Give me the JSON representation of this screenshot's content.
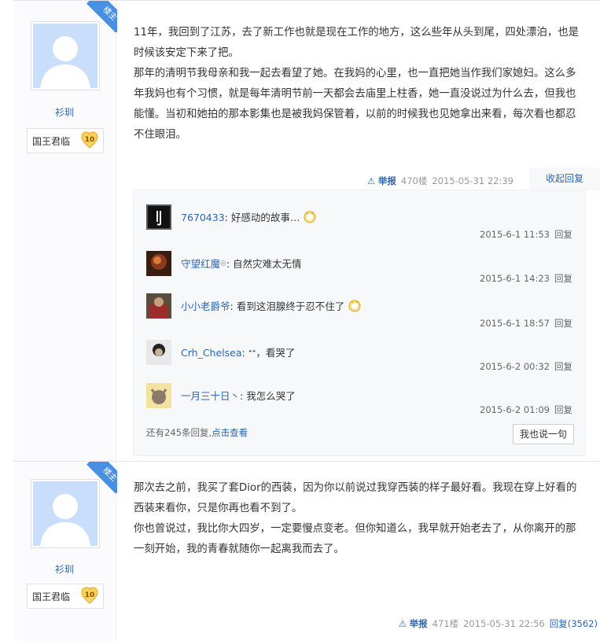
{
  "posts": [
    {
      "owner_tag": "楼主",
      "username": "衫玔",
      "badge_title": "国王君临",
      "badge_level": "10",
      "paragraphs": [
        "11年，我回到了江苏，去了新工作也就是现在工作的地方，这么些年从头到尾，四处漂泊，也是时候该安定下来了把。",
        "那年的清明节我母亲和我一起去看望了她。在我妈的心里，也一直把她当作我们家媳妇。这么多年我妈也有个习惯，就是每年清明节前一天都会去庙里上柱香，她一直没说过为什么去，但我也能懂。当初和她拍的那本影集也是被我妈保管着，以前的时候我也见她拿出来看，每次看也都忍不住眼泪。"
      ],
      "report": "举报",
      "floor": "470楼",
      "time": "2015-05-31 22:39",
      "fold_label": "收起回复",
      "replies": [
        {
          "name": "7670433",
          "text": ": 好感动的故事…",
          "time": "2015-6-1 11:53",
          "reply": "回复",
          "emoji": true
        },
        {
          "name": "守望红魔",
          "mark": "◎",
          "text": ": 自然灾难太无情",
          "time": "2015-6-1 14:23",
          "reply": "回复"
        },
        {
          "name": "小小老爵爷",
          "text": ": 看到这泪腺终于忍不住了",
          "time": "2015-6-1 18:57",
          "reply": "回复",
          "emoji": true
        },
        {
          "name": "Crh_Chelsea",
          "text": ": ᐩᐩ，看哭了",
          "time": "2015-6-2 00:32",
          "reply": "回复"
        },
        {
          "name": "一月三十日丶",
          "text": ": 我怎么哭了",
          "time": "2015-6-2 01:09",
          "reply": "回复"
        }
      ],
      "more_text": "还有245条回复,",
      "more_link": "点击查看",
      "say_button": "我也说一句"
    },
    {
      "owner_tag": "楼主",
      "username": "衫玔",
      "badge_title": "国王君临",
      "badge_level": "10",
      "paragraphs": [
        "那次去之前，我买了套Dior的西装，因为你以前说过我穿西装的样子最好看。我现在穿上好看的西装来看你，只是你再也看不到了。",
        "你也曾说过，我比你大四岁，一定要慢点变老。但你知道么，我早就开始老去了，从你离开的那一刻开始，我的青春就随你一起离我而去了。"
      ],
      "report": "举报",
      "floor": "471楼",
      "time": "2015-05-31 22:56",
      "reply_count_label": "回复(3562)"
    }
  ],
  "colors": {
    "link": "#2d64b3",
    "ribbon": "#4a90e2",
    "avatar_bg": "#c9defa"
  }
}
